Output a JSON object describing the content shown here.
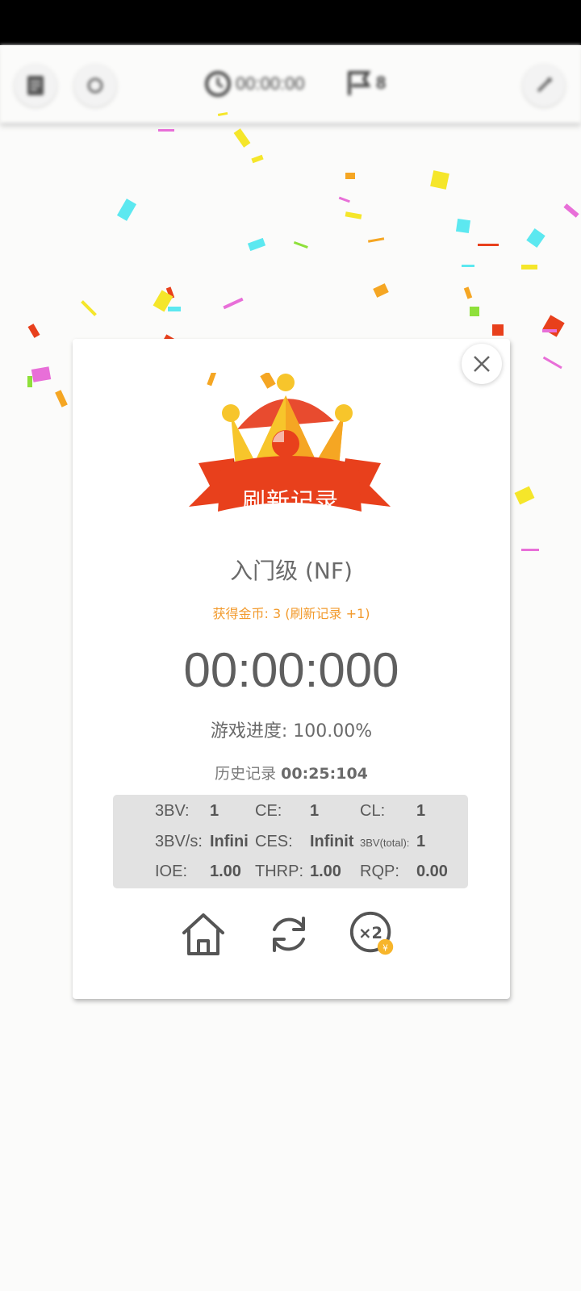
{
  "toolbar": {
    "timer": "00:00:00",
    "flags": "8"
  },
  "result": {
    "banner": "刷新记录",
    "level": "入门级 (NF)",
    "coins": "获得金币: 3 (刷新记录 +1)",
    "time": "00:00:000",
    "progress": "游戏进度: 100.00%",
    "history_label": "历史记录",
    "history_value": "00:25:104"
  },
  "stats": {
    "bv_label": "3BV:",
    "bv_value": "1",
    "ce_label": "CE:",
    "ce_value": "1",
    "cl_label": "CL:",
    "cl_value": "1",
    "bvs_label": "3BV/s:",
    "bvs_value": "Infini",
    "ces_label": "CES:",
    "ces_value": "Infinit",
    "bvtotal_label": "3BV(total):",
    "bvtotal_value": "1",
    "ioe_label": "IOE:",
    "ioe_value": "1.00",
    "thrp_label": "THRP:",
    "thrp_value": "1.00",
    "rqp_label": "RQP:",
    "rqp_value": "0.00"
  },
  "actions": {
    "double_label": "×2",
    "coin_symbol": "¥"
  },
  "colors": {
    "ribbon": "#e8401c",
    "crown_gold": "#f7c52b",
    "crown_red": "#e84b2f",
    "coin_text": "#f29a2c"
  }
}
